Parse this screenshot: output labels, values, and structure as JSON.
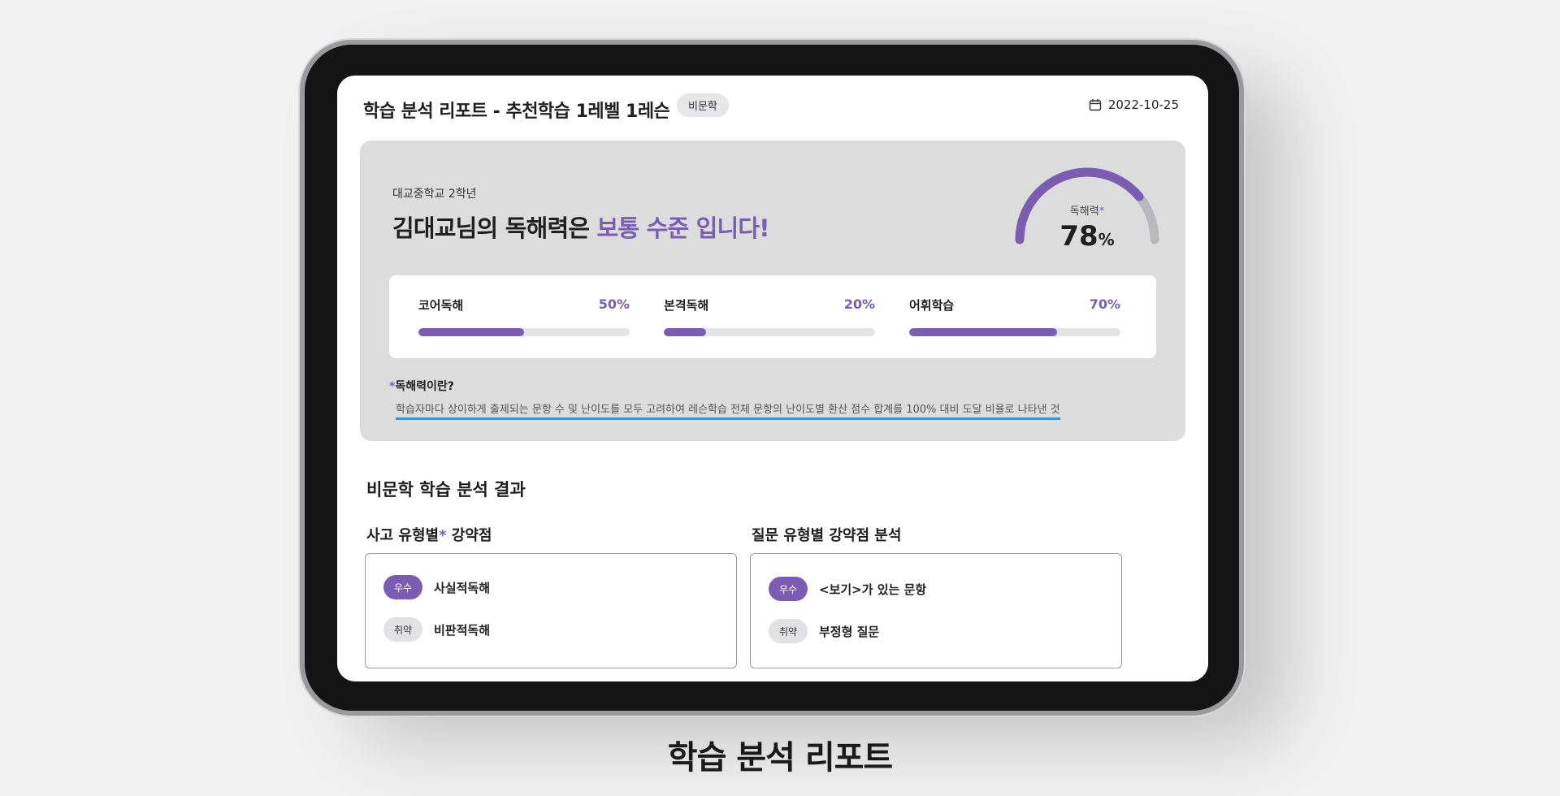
{
  "header": {
    "title": "학습 분석 리포트 - 추천학습 1레벨 1레슨",
    "tag": "비문학",
    "date": "2022-10-25"
  },
  "summary": {
    "school": "대교중학교 2학년",
    "headline_prefix": "김대교님의 독해력은 ",
    "headline_accent": "보통 수준 입니다!",
    "gauge": {
      "label": "독해력",
      "label_star": "*",
      "value": "78",
      "unit": "%",
      "fraction": 0.78
    },
    "metrics": [
      {
        "label": "코어독해",
        "value_text": "50%",
        "fraction": 0.5
      },
      {
        "label": "본격독해",
        "value_text": "20%",
        "fraction": 0.2
      },
      {
        "label": "어휘학습",
        "value_text": "70%",
        "fraction": 0.7
      }
    ],
    "definition": {
      "star": "*",
      "title": "독해력이란?",
      "text": "학습자마다 상이하게 출제되는 문항 수 및 난이도를 모두 고려하여 레슨학습 전체 문항의 난이도별 환산 점수 합계를 100% 대비 도달 비율로 나타낸 것"
    }
  },
  "analysis": {
    "title": "비문학 학습 분석 결과",
    "left": {
      "title": "사고 유형별",
      "title_star": "*",
      "title_suffix": " 강약점",
      "rows": [
        {
          "badge": "우수",
          "label": "사실적독해"
        },
        {
          "badge": "취약",
          "label": "비판적독해"
        }
      ]
    },
    "right": {
      "title": "질문 유형별 강약점 분석",
      "rows": [
        {
          "badge": "우수",
          "label": "<보기>가 있는 문항"
        },
        {
          "badge": "취약",
          "label": "부정형 질문"
        }
      ]
    }
  },
  "caption": "학습 분석 리포트",
  "colors": {
    "accent": "#7b5cb3",
    "link_underline": "#3e8fd6"
  }
}
